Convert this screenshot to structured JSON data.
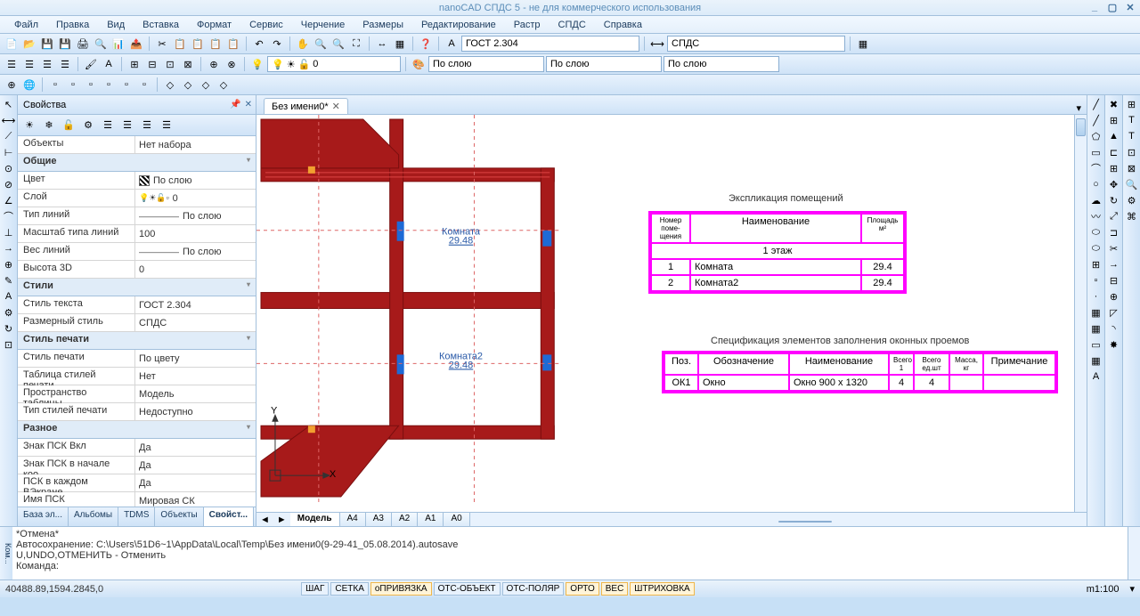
{
  "window": {
    "title": "nanoCAD СПДС 5 - не для коммерческого использования",
    "min": "_",
    "max": "▢",
    "close": "✕"
  },
  "menu": [
    "Файл",
    "Правка",
    "Вид",
    "Вставка",
    "Формат",
    "Сервис",
    "Черчение",
    "Размеры",
    "Редактирование",
    "Растр",
    "СПДС",
    "Справка"
  ],
  "combos": {
    "textstyle": "ГОСТ 2.304",
    "dimstyle": "СПДС",
    "layer_display": "По слою",
    "linetype": "По слою",
    "lineweight": "По слою"
  },
  "properties": {
    "title": "Свойства",
    "selector_label": "Объекты",
    "selector_value": "Нет набора",
    "groups": [
      {
        "name": "Общие",
        "rows": [
          {
            "label": "Цвет",
            "value": "По слою",
            "icon": "hatch"
          },
          {
            "label": "Слой",
            "value": "0",
            "icon": "bulbs"
          },
          {
            "label": "Тип линий",
            "value": "По слою",
            "icon": "line"
          },
          {
            "label": "Масштаб типа линий",
            "value": "100"
          },
          {
            "label": "Вес линий",
            "value": "По слою",
            "icon": "line"
          },
          {
            "label": "Высота 3D",
            "value": "0"
          }
        ]
      },
      {
        "name": "Стили",
        "rows": [
          {
            "label": "Стиль текста",
            "value": "ГОСТ 2.304"
          },
          {
            "label": "Размерный стиль",
            "value": "СПДС"
          }
        ]
      },
      {
        "name": "Стиль печати",
        "rows": [
          {
            "label": "Стиль печати",
            "value": "По цвету"
          },
          {
            "label": "Таблица стилей печати",
            "value": "Нет"
          },
          {
            "label": "Пространство таблицы...",
            "value": "Модель"
          },
          {
            "label": "Тип стилей печати",
            "value": "Недоступно"
          }
        ]
      },
      {
        "name": "Разное",
        "rows": [
          {
            "label": "Знак ПСК Вкл",
            "value": "Да"
          },
          {
            "label": "Знак ПСК в начале коо...",
            "value": "Да"
          },
          {
            "label": "ПСК в каждом ВЭкране",
            "value": "Да"
          },
          {
            "label": "Имя ПСК",
            "value": "Мировая СК"
          }
        ]
      }
    ],
    "tabs": [
      "База эл...",
      "Альбомы",
      "TDMS",
      "Объекты",
      "Свойст..."
    ],
    "active_tab": 4
  },
  "document": {
    "tab_name": "Без имени0*",
    "model_tabs": [
      "Модель",
      "A4",
      "A3",
      "A2",
      "A1",
      "A0"
    ],
    "active_model_tab": 0
  },
  "drawing": {
    "room1_label": "Комната",
    "room1_area": "29.48",
    "room2_label": "Комната2",
    "room2_area": "29.48",
    "ucs_x": "X",
    "ucs_y": "Y"
  },
  "table1": {
    "title": "Экспликация помещений",
    "h1": "Номер поме-щения",
    "h2": "Наименование",
    "h3": "Площадь м²",
    "row_floor": "1 этаж",
    "rows": [
      {
        "num": "1",
        "name": "Комната",
        "area": "29.4"
      },
      {
        "num": "2",
        "name": "Комната2",
        "area": "29.4"
      }
    ]
  },
  "table2": {
    "title": "Спецификация элементов заполнения оконных проемов",
    "h1": "Поз.",
    "h2": "Обозначение",
    "h3": "Наименование",
    "h4": "Всего\n1",
    "h5": "Всего ед.шт",
    "h6": "Масса, кг",
    "h7": "Примечание",
    "row": {
      "pos": "ОК1",
      "obz": "Окно",
      "name": "Окно 900 x 1320",
      "c4": "4",
      "c5": "4",
      "c6": "",
      "c7": ""
    }
  },
  "cmdline": {
    "vlabel": "Ком...",
    "lines": [
      "*Отмена*",
      "Автосохранение: C:\\Users\\51D6~1\\AppData\\Local\\Temp\\Без имени0(9-29-41_05.08.2014).autosave",
      "U,UNDO,ОТМЕНИТЬ - Отменить",
      "Команда:"
    ]
  },
  "status": {
    "coords": "40488.89,1594.2845,0",
    "toggles": [
      {
        "label": "ШАГ",
        "on": false
      },
      {
        "label": "СЕТКА",
        "on": false
      },
      {
        "label": "оПРИВЯЗКА",
        "on": true
      },
      {
        "label": "ОТС-ОБЪЕКТ",
        "on": false
      },
      {
        "label": "ОТС-ПОЛЯР",
        "on": false
      },
      {
        "label": "ОРТО",
        "on": true
      },
      {
        "label": "ВЕС",
        "on": true
      },
      {
        "label": "ШТРИХОВКА",
        "on": true
      }
    ],
    "scale": "m1:100"
  }
}
